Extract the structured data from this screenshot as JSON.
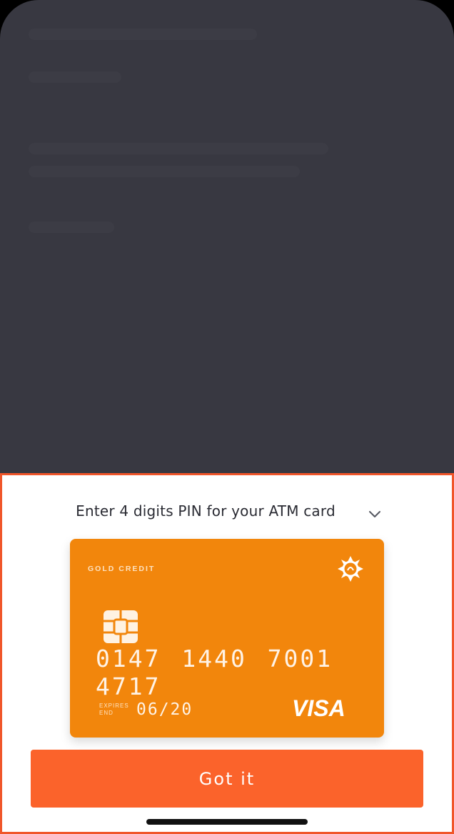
{
  "sheet": {
    "title": "Enter 4 digits PIN for your ATM card"
  },
  "card": {
    "type": "GOLD CREDIT",
    "number": "0147 1440 7001 4717",
    "expires_label_1": "EXPIRES",
    "expires_label_2": "END",
    "expires_value": "06/20",
    "brand": "VISA",
    "color": "#f2860c"
  },
  "actions": {
    "confirm_label": "Got it",
    "confirm_color": "#fb632b"
  },
  "icons": {
    "collapse": "chevron-down-icon",
    "card_logo": "card-logo-icon",
    "chip": "chip-icon"
  }
}
